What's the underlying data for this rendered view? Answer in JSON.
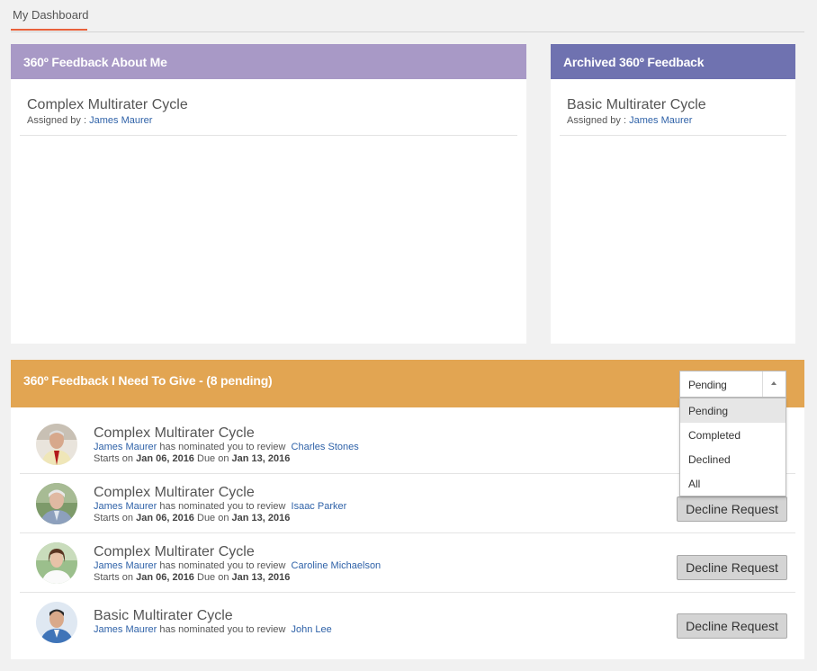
{
  "tabs": [
    {
      "label": "My Dashboard"
    }
  ],
  "about_me": {
    "title": "360º Feedback About Me",
    "items": [
      {
        "title": "Complex Multirater Cycle",
        "assigned_prefix": "Assigned by :",
        "assigned_by": "James Maurer"
      }
    ]
  },
  "archived": {
    "title": "Archived 360º Feedback",
    "items": [
      {
        "title": "Basic Multirater Cycle",
        "assigned_prefix": "Assigned by :",
        "assigned_by": "James Maurer"
      }
    ]
  },
  "to_give": {
    "title": "360º Feedback I Need To Give - (8 pending)",
    "filter": {
      "selected": "Pending",
      "options": [
        "Pending",
        "Completed",
        "Declined",
        "All"
      ]
    },
    "nomination_text": "has nominated you to review",
    "starts_label": "Starts on",
    "due_label": "Due on",
    "decline_label": "Decline Request",
    "requests": [
      {
        "title": "Complex Multirater Cycle",
        "nominator": "James Maurer",
        "reviewee": "Charles Stones",
        "start": "Jan 06, 2016",
        "due": "Jan 13, 2016"
      },
      {
        "title": "Complex Multirater Cycle",
        "nominator": "James Maurer",
        "reviewee": "Isaac Parker",
        "start": "Jan 06, 2016",
        "due": "Jan 13, 2016"
      },
      {
        "title": "Complex Multirater Cycle",
        "nominator": "James Maurer",
        "reviewee": "Caroline Michaelson",
        "start": "Jan 06, 2016",
        "due": "Jan 13, 2016"
      },
      {
        "title": "Basic Multirater Cycle",
        "nominator": "James Maurer",
        "reviewee": "John Lee"
      }
    ]
  },
  "colors": {
    "accent_tab": "#e8603a",
    "about_me_header": "#a899c6",
    "archived_header": "#6f72b0",
    "to_give_header": "#e2a552",
    "link": "#2f62a8"
  }
}
